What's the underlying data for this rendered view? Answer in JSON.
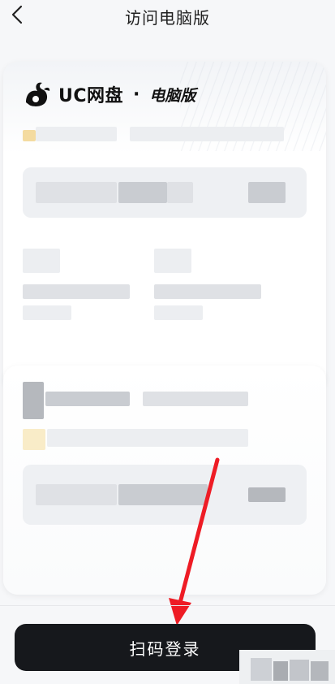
{
  "header": {
    "title": "访问电脑版"
  },
  "brand": {
    "name": "UC网盘",
    "separator": "·",
    "suffix": "电脑版"
  },
  "footer": {
    "scan_login_label": "扫码登录"
  },
  "colors": {
    "button_bg": "#16181c",
    "annotation_arrow": "#ee1c25"
  },
  "icons": {
    "back": "chevron-left-icon",
    "logo": "uc-squirrel-logo-icon"
  }
}
